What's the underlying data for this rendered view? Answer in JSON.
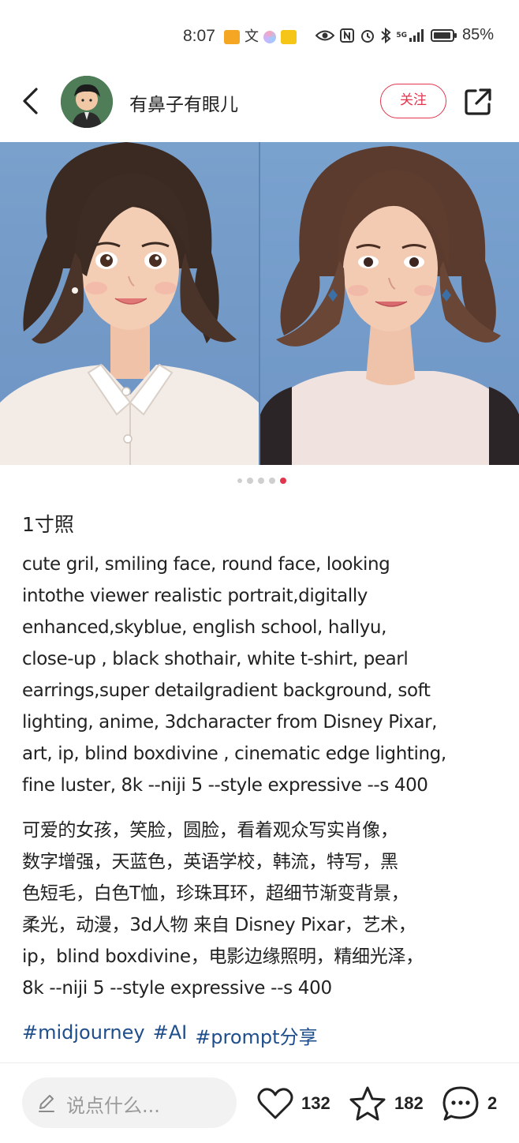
{
  "status_bar": {
    "time": "8:07",
    "battery_percent": "85%",
    "network_label": "5G"
  },
  "header": {
    "username": "有鼻子有眼儿",
    "follow_label": "关注"
  },
  "carousel": {
    "total_images": 5,
    "active_index": 4
  },
  "post": {
    "title": "1寸照",
    "body_en_lines": [
      "cute gril, smiling face, round face, looking",
      "intothe viewer realistic portrait,digitally",
      "enhanced,skyblue, english school, hallyu,",
      "close-up , black shothair, white t-shirt, pearl",
      "earrings,super detailgradient background, soft",
      "lighting, anime, 3dcharacter from Disney Pixar,",
      "art, ip, blind boxdivine , cinematic edge lighting,",
      "fine luster, 8k --niji 5 --style expressive --s 400"
    ],
    "body_zh_lines": [
      "可爱的女孩，笑脸，圆脸，看着观众写实肖像，",
      "数字增强，天蓝色，英语学校，韩流，特写，黑",
      "色短毛，白色T恤，珍珠耳环，超细节渐变背景，",
      "柔光，动漫，3d人物 来自 Disney Pixar，艺术，",
      "ip，blind boxdivine，电影边缘照明，精细光泽，",
      "8k --niji 5 --style expressive --s 400"
    ],
    "tags": [
      "#midjourney",
      "#AI",
      "#prompt分享"
    ]
  },
  "bottom_bar": {
    "comment_placeholder": "说点什么...",
    "like_count": "132",
    "favorite_count": "182",
    "comment_count": "2"
  },
  "colors": {
    "accent": "#e2354d",
    "tag": "#1f4e8c",
    "sky_background": "#6f97c6"
  }
}
